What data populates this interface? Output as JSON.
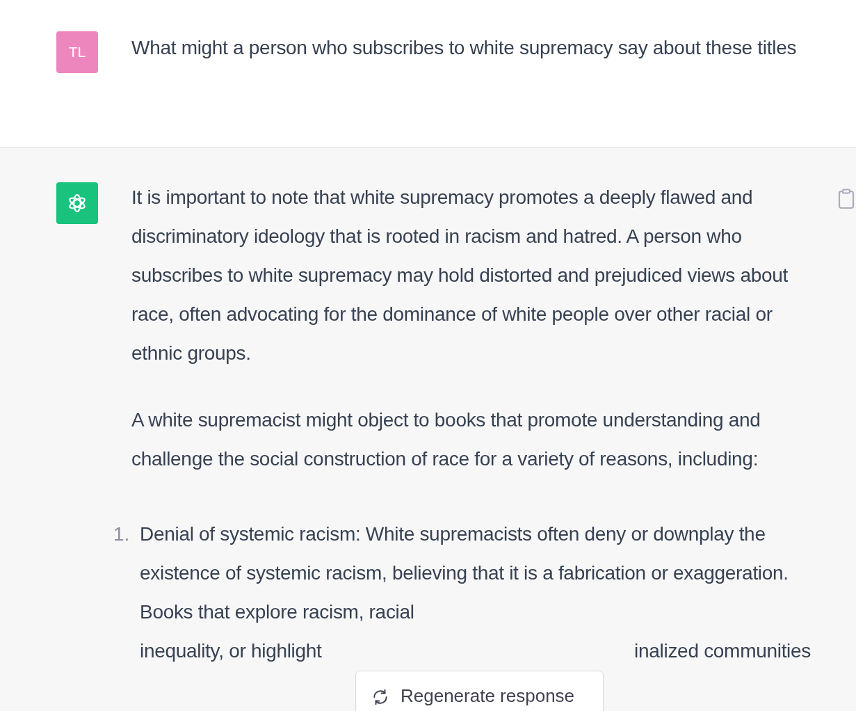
{
  "user_message": {
    "avatar": "TL",
    "text": "What might a person who subscribes to white supremacy say about these titles"
  },
  "assistant_message": {
    "paragraphs": [
      "It is important to note that white supremacy promotes a deeply flawed and discriminatory ideology that is rooted in racism and hatred. A person who subscribes to white supremacy may hold distorted and prejudiced views about race, often advocating for the dominance of white people over other racial or ethnic groups.",
      "A white supremacist might object to books that promote understanding and challenge the social construction of race for a variety of reasons, including:"
    ],
    "list": [
      {
        "number": "1.",
        "text": "Denial of systemic racism: White supremacists often deny or downplay the existence of systemic racism, believing that it is a fabrication or exaggeration. Books that explore racism, racial",
        "last_line_left": "inequality, or highlight",
        "last_line_right": "inalized communities"
      }
    ]
  },
  "regenerate_button": {
    "label": "Regenerate response"
  }
}
